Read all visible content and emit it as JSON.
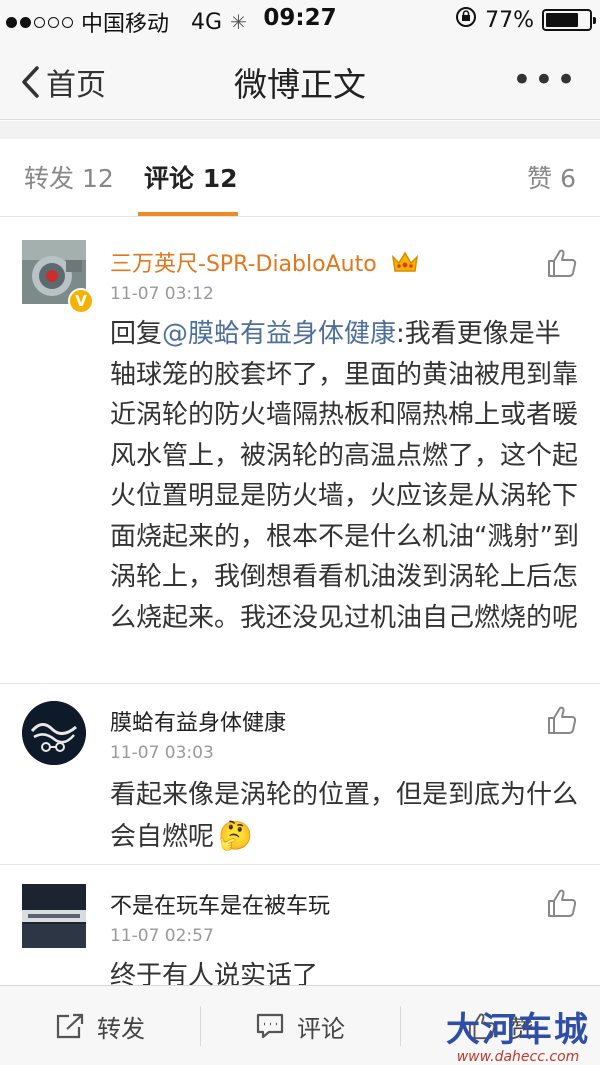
{
  "status_bar": {
    "carrier": "中国移动",
    "network": "4G",
    "time": "09:27",
    "battery": "77%",
    "battery_level": 0.77,
    "signal_bars_filled": 2,
    "signal_bars_total": 5
  },
  "nav": {
    "back_label": "首页",
    "title": "微博正文",
    "more_label": "•••"
  },
  "tabs": [
    {
      "label": "转发 12"
    },
    {
      "label": "评论 12"
    },
    {
      "label": "赞 6"
    }
  ],
  "comments": [
    {
      "username": "三万英尺-SPR-DiabloAuto",
      "time": "11-07 03:12",
      "reply_prefix": "回复",
      "mention": "@膜蛤有益身体健康",
      "text": ":我看更像是半轴球笼的胶套坏了，里面的黄油被甩到靠近涡轮的防火墙隔热板和隔热棉上或者暖风水管上，被涡轮的高温点燃了，这个起火位置明显是防火墙，火应该是从涡轮下面烧起来的，根本不是什么机油“溅射”到涡轮上，我倒想看看机油泼到涡轮上后怎么烧起来。我还没见过机油自己燃烧的呢",
      "verified_badge": "V"
    },
    {
      "username": "膜蛤有益身体健康",
      "time": "11-07 03:03",
      "text": "看起来像是涡轮的位置，但是到底为什么会自燃呢",
      "emoji": "🤔"
    },
    {
      "username": "不是在玩车是在被车玩",
      "time": "11-07 02:57",
      "text": "终于有人说实话了"
    }
  ],
  "toolbar": {
    "repost": "转发",
    "comment": "评论",
    "like": "赞"
  },
  "watermark": {
    "main": "大河车城",
    "sub": "www.dahecc.com"
  },
  "colors": {
    "accent": "#f08a24",
    "vip_name": "#e2771c",
    "mention": "#4d6f9c"
  }
}
